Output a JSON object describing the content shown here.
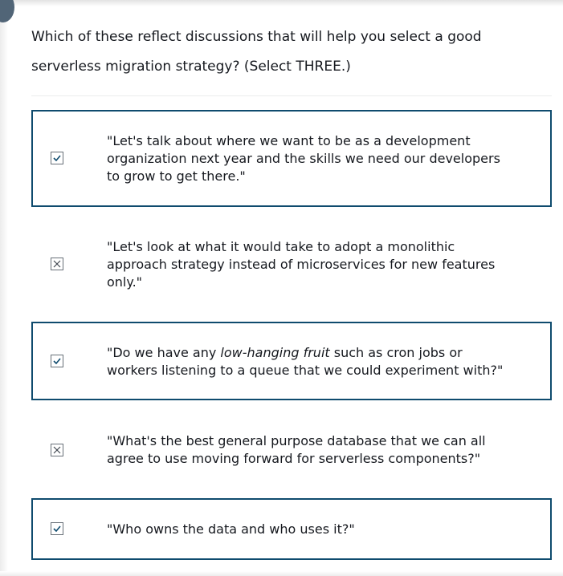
{
  "question": {
    "text": "Which of these reflect discussions that will help you select a good serverless migration strategy? (Select THREE.)"
  },
  "options": [
    {
      "text": "\"Let's talk about where we want to be as a development organization next year and the skills we need our developers to grow to get there.\"",
      "marker": "check-icon",
      "selected": true
    },
    {
      "text": "\"Let's look at what it would take to adopt a monolithic approach strategy instead of microservices for new features only.\"",
      "marker": "x-icon",
      "selected": false
    },
    {
      "text_before": "\"Do we have any ",
      "text_em": "low-hanging fruit",
      "text_after": " such as cron jobs or workers listening to a queue that we could experiment with?\"",
      "marker": "check-icon",
      "selected": true
    },
    {
      "text": "\"What's the best general purpose database that we can all agree to use moving forward for serverless components?\"",
      "marker": "x-icon",
      "selected": false
    },
    {
      "text": "\"Who owns the data and who uses it?\"",
      "marker": "check-icon",
      "selected": true
    }
  ],
  "colors": {
    "selected_border": "#0f4b6e",
    "text": "#16191f",
    "marker": "#0f4b6e"
  }
}
